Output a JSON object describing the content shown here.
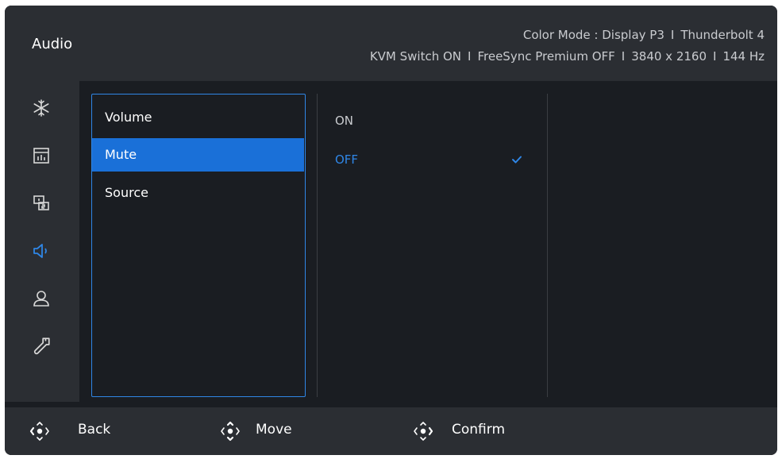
{
  "header": {
    "title": "Audio",
    "info_line1": [
      "Color Mode : Display P3",
      "Thunderbolt 4"
    ],
    "info_line2": [
      "KVM Switch ON",
      "FreeSync Premium OFF",
      "3840 x 2160",
      "144 Hz"
    ],
    "separator": "I"
  },
  "sidebar": {
    "items": [
      {
        "icon": "snowflake-icon"
      },
      {
        "icon": "picture-adjust-icon"
      },
      {
        "icon": "multi-display-icon"
      },
      {
        "icon": "speaker-icon",
        "active": true
      },
      {
        "icon": "user-icon"
      },
      {
        "icon": "wrench-icon"
      }
    ]
  },
  "submenu": {
    "items": [
      {
        "label": "Volume"
      },
      {
        "label": "Mute",
        "selected": true
      },
      {
        "label": "Source"
      }
    ]
  },
  "options": {
    "items": [
      {
        "label": "ON"
      },
      {
        "label": "OFF",
        "checked": true
      }
    ]
  },
  "footer": {
    "back_label": "Back",
    "move_label": "Move",
    "confirm_label": "Confirm"
  },
  "colors": {
    "accent": "#1a70d8",
    "accent_text": "#2f86e6",
    "background": "#1a1d22",
    "panel": "#2b2e33"
  }
}
